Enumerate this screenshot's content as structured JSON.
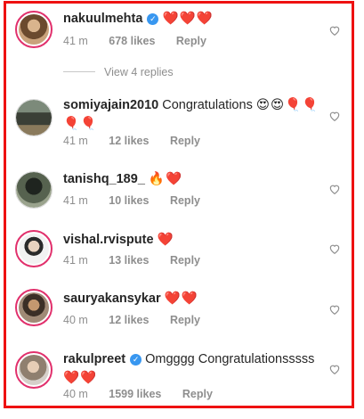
{
  "comments": [
    {
      "username": "nakuulmehta",
      "verified": true,
      "text": "",
      "emoji": "❤️❤️❤️",
      "time": "41 m",
      "likes": "678 likes",
      "reply": "Reply",
      "avatar_color": "#7a5a3c"
    },
    {
      "username": "somiyajain2010",
      "verified": false,
      "text": "Congratulations",
      "emoji": "😍😍🎈🎈🎈🎈",
      "time": "41 m",
      "likes": "12 likes",
      "reply": "Reply",
      "avatar_color": "#3e4a3a"
    },
    {
      "username": "tanishq_189_",
      "verified": false,
      "text": "",
      "emoji": "🔥❤️",
      "time": "41 m",
      "likes": "10 likes",
      "reply": "Reply",
      "avatar_color": "#2d3a2f"
    },
    {
      "username": "vishal.rvispute",
      "verified": false,
      "text": "",
      "emoji": "❤️",
      "time": "41 m",
      "likes": "13 likes",
      "reply": "Reply",
      "avatar_color": "#cfcfcf"
    },
    {
      "username": "sauryakansykar",
      "verified": false,
      "text": "",
      "emoji": "❤️❤️",
      "time": "40 m",
      "likes": "12 likes",
      "reply": "Reply",
      "avatar_color": "#4b4036"
    },
    {
      "username": "rakulpreet",
      "verified": true,
      "text": "Omgggg Congratulationsssss",
      "emoji": "❤️❤️",
      "time": "40 m",
      "likes": "1599 likes",
      "reply": "Reply",
      "avatar_color": "#9a8f86"
    }
  ],
  "view_replies": "View 4 replies",
  "colors": {
    "border": "#ee1111",
    "story_ring": "#e1306c",
    "verified": "#3897f0",
    "meta": "#8e8e8e"
  }
}
